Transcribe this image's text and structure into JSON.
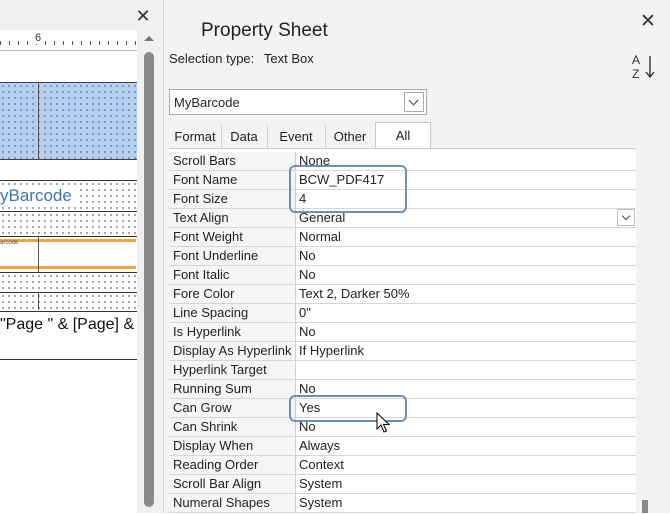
{
  "design_view": {
    "ruler_mark": "6",
    "barcode_field_text": "yBarcode",
    "barcode_caption": "arcode",
    "page_expression": "\"Page \" & [Page] &"
  },
  "property_sheet": {
    "title": "Property Sheet",
    "selection_type_label": "Selection type:",
    "selection_type_value": "Text Box",
    "sort_icon": "sort-az-icon",
    "object_combo_value": "MyBarcode",
    "tabs": [
      {
        "label": "Format",
        "active": false
      },
      {
        "label": "Data",
        "active": false
      },
      {
        "label": "Event",
        "active": false
      },
      {
        "label": "Other",
        "active": false
      },
      {
        "label": "All",
        "active": true
      }
    ],
    "rows": [
      {
        "name": "Scroll Bars",
        "value": "None"
      },
      {
        "name": "Font Name",
        "value": "BCW_PDF417"
      },
      {
        "name": "Font Size",
        "value": "4"
      },
      {
        "name": "Text Align",
        "value": "General"
      },
      {
        "name": "Font Weight",
        "value": "Normal"
      },
      {
        "name": "Font Underline",
        "value": "No"
      },
      {
        "name": "Font Italic",
        "value": "No"
      },
      {
        "name": "Fore Color",
        "value": "Text 2, Darker 50%"
      },
      {
        "name": "Line Spacing",
        "value": "0\""
      },
      {
        "name": "Is Hyperlink",
        "value": "No"
      },
      {
        "name": "Display As Hyperlink",
        "value": "If Hyperlink"
      },
      {
        "name": "Hyperlink Target",
        "value": ""
      },
      {
        "name": "Running Sum",
        "value": "No"
      },
      {
        "name": "Can Grow",
        "value": "Yes"
      },
      {
        "name": "Can Shrink",
        "value": "No"
      },
      {
        "name": "Display When",
        "value": "Always"
      },
      {
        "name": "Reading Order",
        "value": "Context"
      },
      {
        "name": "Scroll Bar Align",
        "value": "System"
      },
      {
        "name": "Numeral Shapes",
        "value": "System"
      }
    ]
  },
  "colors": {
    "highlight_border": "#6f8fb8",
    "section_blue": "#b7cff0",
    "orange_line": "#f2a33a",
    "field_text": "#3c78b8"
  }
}
